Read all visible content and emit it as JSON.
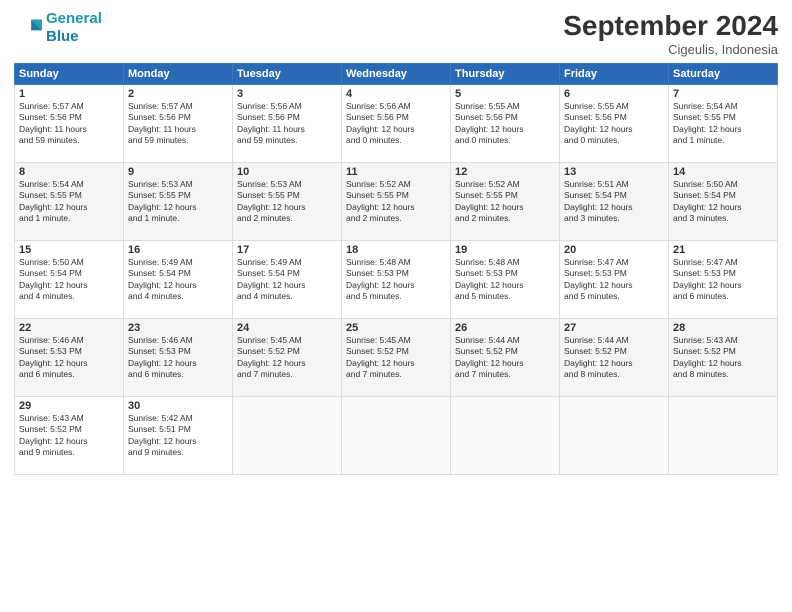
{
  "header": {
    "logo_line1": "General",
    "logo_line2": "Blue",
    "month": "September 2024",
    "location": "Cigeulis, Indonesia"
  },
  "days_of_week": [
    "Sunday",
    "Monday",
    "Tuesday",
    "Wednesday",
    "Thursday",
    "Friday",
    "Saturday"
  ],
  "weeks": [
    [
      {
        "day": "1",
        "info": "Sunrise: 5:57 AM\nSunset: 5:56 PM\nDaylight: 11 hours\nand 59 minutes."
      },
      {
        "day": "2",
        "info": "Sunrise: 5:57 AM\nSunset: 5:56 PM\nDaylight: 11 hours\nand 59 minutes."
      },
      {
        "day": "3",
        "info": "Sunrise: 5:56 AM\nSunset: 5:56 PM\nDaylight: 11 hours\nand 59 minutes."
      },
      {
        "day": "4",
        "info": "Sunrise: 5:56 AM\nSunset: 5:56 PM\nDaylight: 12 hours\nand 0 minutes."
      },
      {
        "day": "5",
        "info": "Sunrise: 5:55 AM\nSunset: 5:56 PM\nDaylight: 12 hours\nand 0 minutes."
      },
      {
        "day": "6",
        "info": "Sunrise: 5:55 AM\nSunset: 5:56 PM\nDaylight: 12 hours\nand 0 minutes."
      },
      {
        "day": "7",
        "info": "Sunrise: 5:54 AM\nSunset: 5:55 PM\nDaylight: 12 hours\nand 1 minute."
      }
    ],
    [
      {
        "day": "8",
        "info": "Sunrise: 5:54 AM\nSunset: 5:55 PM\nDaylight: 12 hours\nand 1 minute."
      },
      {
        "day": "9",
        "info": "Sunrise: 5:53 AM\nSunset: 5:55 PM\nDaylight: 12 hours\nand 1 minute."
      },
      {
        "day": "10",
        "info": "Sunrise: 5:53 AM\nSunset: 5:55 PM\nDaylight: 12 hours\nand 2 minutes."
      },
      {
        "day": "11",
        "info": "Sunrise: 5:52 AM\nSunset: 5:55 PM\nDaylight: 12 hours\nand 2 minutes."
      },
      {
        "day": "12",
        "info": "Sunrise: 5:52 AM\nSunset: 5:55 PM\nDaylight: 12 hours\nand 2 minutes."
      },
      {
        "day": "13",
        "info": "Sunrise: 5:51 AM\nSunset: 5:54 PM\nDaylight: 12 hours\nand 3 minutes."
      },
      {
        "day": "14",
        "info": "Sunrise: 5:50 AM\nSunset: 5:54 PM\nDaylight: 12 hours\nand 3 minutes."
      }
    ],
    [
      {
        "day": "15",
        "info": "Sunrise: 5:50 AM\nSunset: 5:54 PM\nDaylight: 12 hours\nand 4 minutes."
      },
      {
        "day": "16",
        "info": "Sunrise: 5:49 AM\nSunset: 5:54 PM\nDaylight: 12 hours\nand 4 minutes."
      },
      {
        "day": "17",
        "info": "Sunrise: 5:49 AM\nSunset: 5:54 PM\nDaylight: 12 hours\nand 4 minutes."
      },
      {
        "day": "18",
        "info": "Sunrise: 5:48 AM\nSunset: 5:53 PM\nDaylight: 12 hours\nand 5 minutes."
      },
      {
        "day": "19",
        "info": "Sunrise: 5:48 AM\nSunset: 5:53 PM\nDaylight: 12 hours\nand 5 minutes."
      },
      {
        "day": "20",
        "info": "Sunrise: 5:47 AM\nSunset: 5:53 PM\nDaylight: 12 hours\nand 5 minutes."
      },
      {
        "day": "21",
        "info": "Sunrise: 5:47 AM\nSunset: 5:53 PM\nDaylight: 12 hours\nand 6 minutes."
      }
    ],
    [
      {
        "day": "22",
        "info": "Sunrise: 5:46 AM\nSunset: 5:53 PM\nDaylight: 12 hours\nand 6 minutes."
      },
      {
        "day": "23",
        "info": "Sunrise: 5:46 AM\nSunset: 5:53 PM\nDaylight: 12 hours\nand 6 minutes."
      },
      {
        "day": "24",
        "info": "Sunrise: 5:45 AM\nSunset: 5:52 PM\nDaylight: 12 hours\nand 7 minutes."
      },
      {
        "day": "25",
        "info": "Sunrise: 5:45 AM\nSunset: 5:52 PM\nDaylight: 12 hours\nand 7 minutes."
      },
      {
        "day": "26",
        "info": "Sunrise: 5:44 AM\nSunset: 5:52 PM\nDaylight: 12 hours\nand 7 minutes."
      },
      {
        "day": "27",
        "info": "Sunrise: 5:44 AM\nSunset: 5:52 PM\nDaylight: 12 hours\nand 8 minutes."
      },
      {
        "day": "28",
        "info": "Sunrise: 5:43 AM\nSunset: 5:52 PM\nDaylight: 12 hours\nand 8 minutes."
      }
    ],
    [
      {
        "day": "29",
        "info": "Sunrise: 5:43 AM\nSunset: 5:52 PM\nDaylight: 12 hours\nand 9 minutes."
      },
      {
        "day": "30",
        "info": "Sunrise: 5:42 AM\nSunset: 5:51 PM\nDaylight: 12 hours\nand 9 minutes."
      },
      {
        "day": "",
        "info": ""
      },
      {
        "day": "",
        "info": ""
      },
      {
        "day": "",
        "info": ""
      },
      {
        "day": "",
        "info": ""
      },
      {
        "day": "",
        "info": ""
      }
    ]
  ]
}
